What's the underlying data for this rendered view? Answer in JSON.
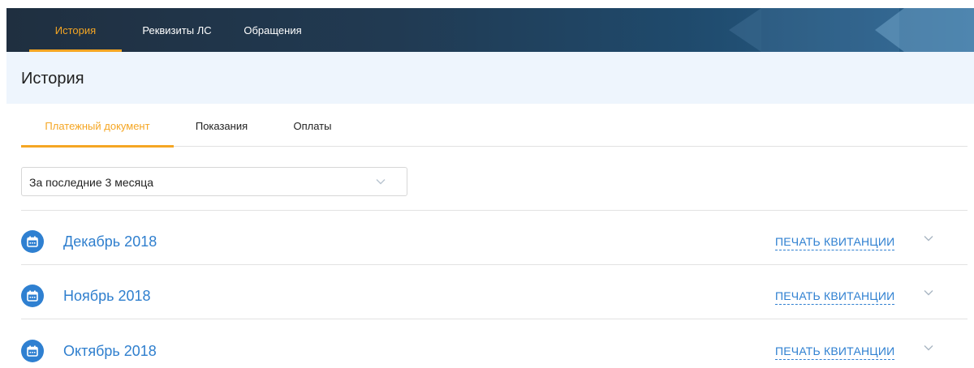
{
  "nav": {
    "tabs": [
      {
        "label": "История",
        "active": true
      },
      {
        "label": "Реквизиты ЛС",
        "active": false
      },
      {
        "label": "Обращения",
        "active": false
      }
    ]
  },
  "page": {
    "title": "История"
  },
  "subtabs": [
    {
      "label": "Платежный документ",
      "active": true
    },
    {
      "label": "Показания",
      "active": false
    },
    {
      "label": "Оплаты",
      "active": false
    }
  ],
  "filter": {
    "selected": "За последние 3 месяца"
  },
  "months": [
    {
      "title": "Декабрь 2018",
      "print_label": "ПЕЧАТЬ КВИТАНЦИИ"
    },
    {
      "title": "Ноябрь 2018",
      "print_label": "ПЕЧАТЬ КВИТАНЦИИ"
    },
    {
      "title": "Октябрь 2018",
      "print_label": "ПЕЧАТЬ КВИТАНЦИИ"
    }
  ],
  "colors": {
    "accent": "#f5a623",
    "link": "#2f80d1",
    "nav_bg": "#213a52",
    "header_bg": "#eef5fd"
  },
  "icons": {
    "month": "calendar-icon",
    "expand": "chevron-down-icon",
    "select": "chevron-down-icon"
  }
}
